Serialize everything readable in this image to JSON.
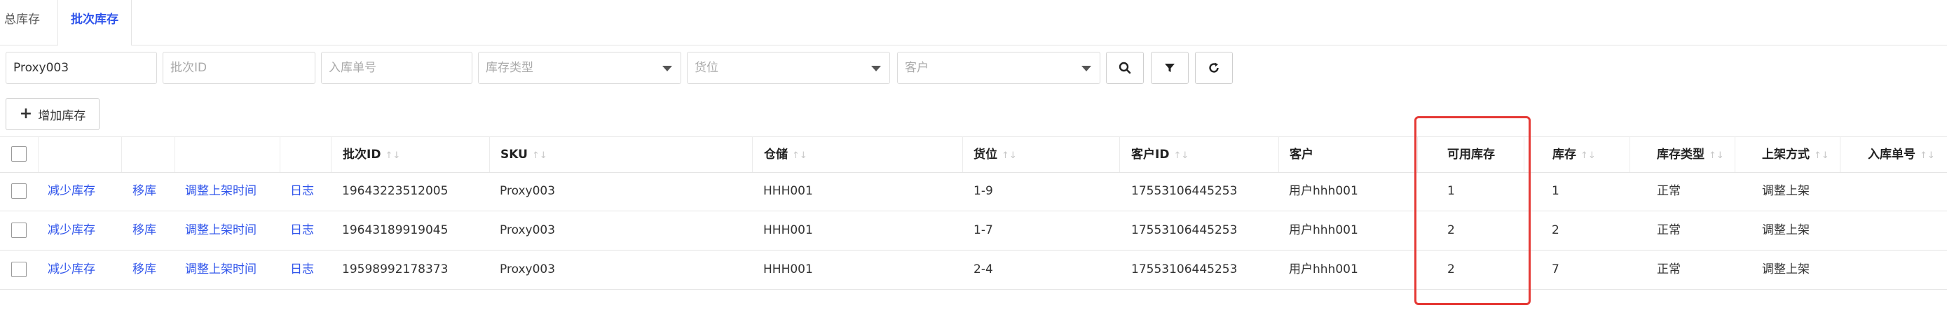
{
  "tabs": [
    "总库存",
    "批次库存"
  ],
  "filters": {
    "sku_value": "Proxy003",
    "batch_id_placeholder": "批次ID",
    "inbound_no_placeholder": "入库单号",
    "stock_type_placeholder": "库存类型",
    "location_placeholder": "货位",
    "customer_placeholder": "客户"
  },
  "toolbar": {
    "add_stock_label": "增加库存"
  },
  "table": {
    "headers": [
      "批次ID",
      "SKU",
      "仓储",
      "货位",
      "客户ID",
      "客户",
      "可用库存",
      "库存",
      "库存类型",
      "上架方式",
      "入库单号"
    ],
    "actions": [
      "减少库存",
      "移库",
      "调整上架时间",
      "日志"
    ],
    "rows": [
      {
        "batch_id": "19643223512005",
        "sku": "Proxy003",
        "warehouse": "HHH001",
        "location": "1-9",
        "customer_id": "17553106445253",
        "customer": "用户hhh001",
        "available": "1",
        "stock": "1",
        "stock_type": "正常",
        "shelf_method": "调整上架",
        "inbound_no": ""
      },
      {
        "batch_id": "19643189919045",
        "sku": "Proxy003",
        "warehouse": "HHH001",
        "location": "1-7",
        "customer_id": "17553106445253",
        "customer": "用户hhh001",
        "available": "2",
        "stock": "2",
        "stock_type": "正常",
        "shelf_method": "调整上架",
        "inbound_no": ""
      },
      {
        "batch_id": "19598992178373",
        "sku": "Proxy003",
        "warehouse": "HHH001",
        "location": "2-4",
        "customer_id": "17553106445253",
        "customer": "用户hhh001",
        "available": "2",
        "stock": "7",
        "stock_type": "正常",
        "shelf_method": "调整上架",
        "inbound_no": ""
      }
    ]
  },
  "colors": {
    "accent": "#2f54eb",
    "highlight": "#e53935"
  }
}
